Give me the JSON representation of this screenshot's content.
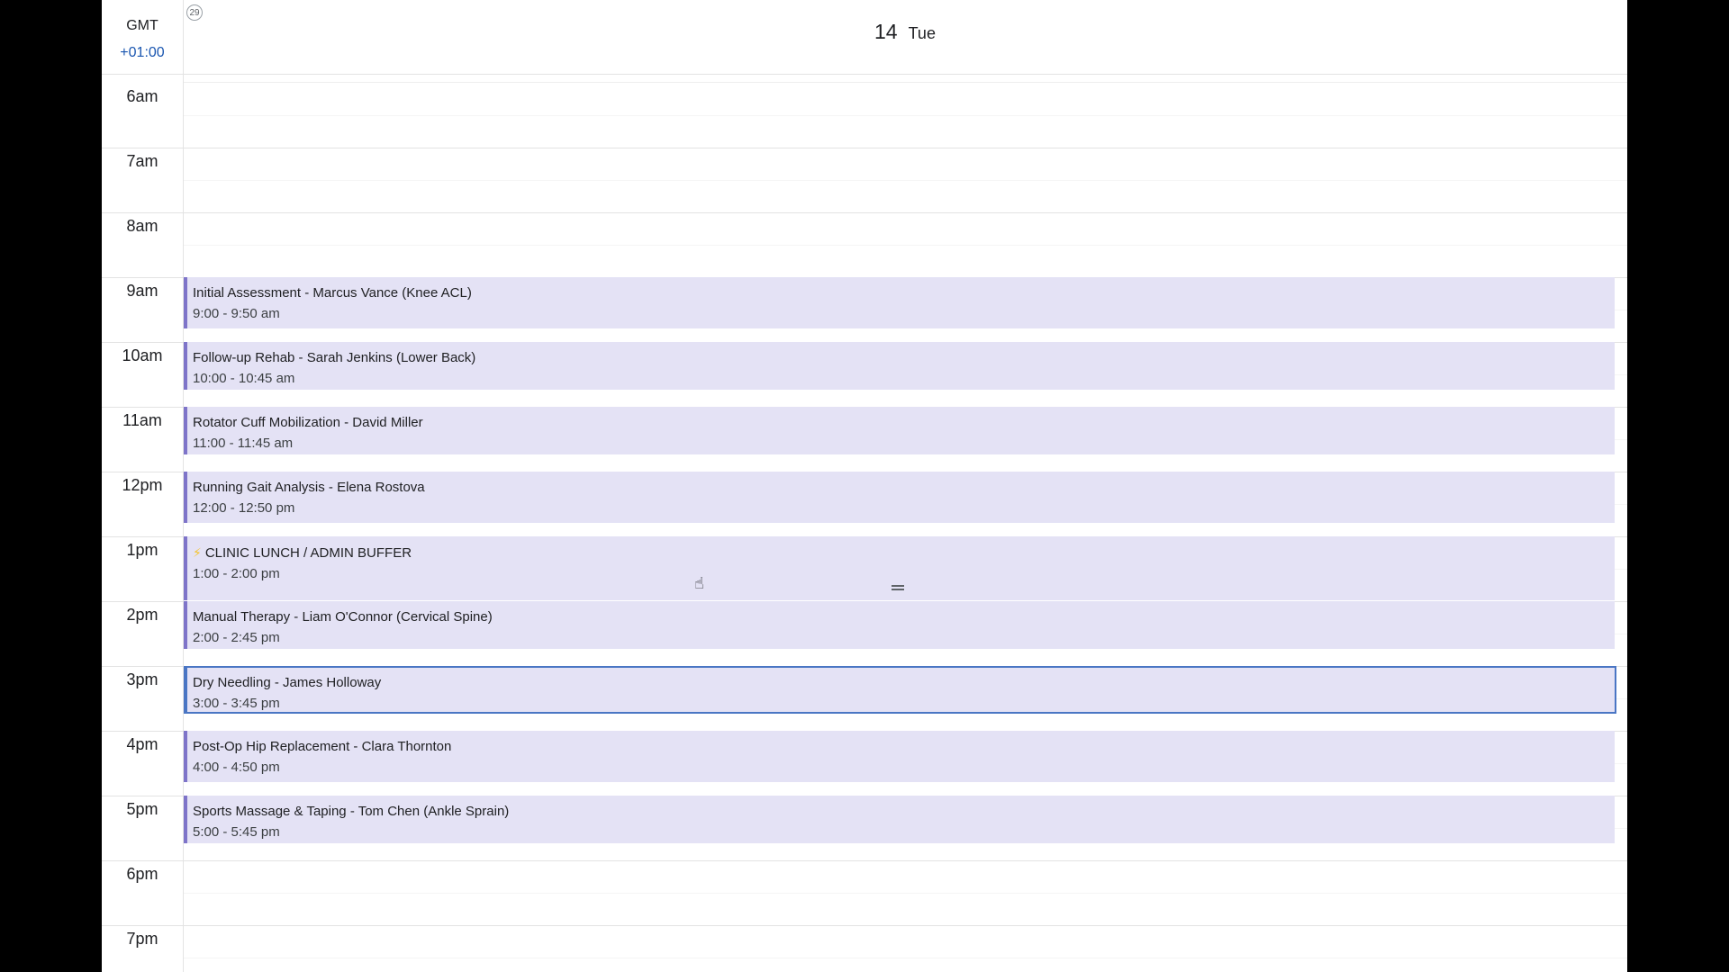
{
  "header": {
    "timezone_label": "GMT",
    "timezone_offset": "+01:00",
    "week_number": "29",
    "day_number": "14",
    "day_name": "Tue"
  },
  "hours": [
    "6am",
    "7am",
    "8am",
    "9am",
    "10am",
    "11am",
    "12pm",
    "1pm",
    "2pm",
    "3pm",
    "4pm",
    "5pm",
    "6pm",
    "7pm"
  ],
  "events": [
    {
      "title": "Initial Assessment - Marcus Vance (Knee ACL)",
      "time": "9:00 - 9:50 am"
    },
    {
      "title": "Follow-up Rehab - Sarah Jenkins (Lower Back)",
      "time": "10:00 - 10:45 am"
    },
    {
      "title": "Rotator Cuff Mobilization - David Miller",
      "time": "11:00 - 11:45 am"
    },
    {
      "title": "Running Gait Analysis - Elena Rostova",
      "time": "12:00 - 12:50 pm"
    },
    {
      "title": "CLINIC LUNCH / ADMIN BUFFER",
      "time": "1:00 - 2:00 pm",
      "icon": "lightning-bolt-icon"
    },
    {
      "title": "Manual Therapy - Liam O'Connor (Cervical Spine)",
      "time": "2:00 - 2:45 pm"
    },
    {
      "title": "Dry Needling - James Holloway",
      "time": "3:00 - 3:45 pm",
      "selected": true
    },
    {
      "title": "Post-Op Hip Replacement - Clara Thornton",
      "time": "4:00 - 4:50 pm"
    },
    {
      "title": "Sports Massage & Taping - Tom Chen (Ankle Sprain)",
      "time": "5:00 - 5:45 pm"
    }
  ],
  "colors": {
    "event_bg": "#e4e2f5",
    "event_accent": "#7e74c9",
    "selected_border": "#4a76c4",
    "timezone_offset": "#1a56b0"
  }
}
